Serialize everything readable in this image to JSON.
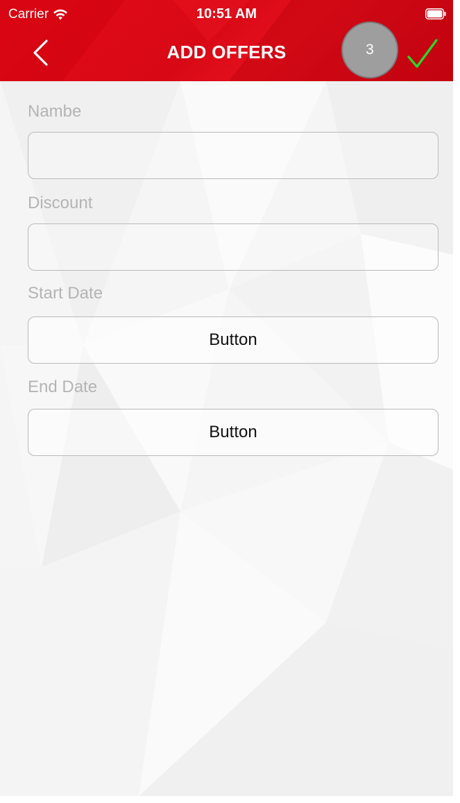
{
  "status_bar": {
    "carrier": "Carrier",
    "time": "10:51 AM",
    "wifi_icon": "wifi-icon",
    "battery_icon": "battery-icon"
  },
  "navbar": {
    "title": "ADD OFFERS",
    "back_icon": "chevron-left-icon",
    "badge_count": "3",
    "confirm_icon": "checkmark-icon",
    "background_color": "#e30613",
    "confirm_color": "#2bd62b"
  },
  "form": {
    "name": {
      "label": "Nambe",
      "value": "",
      "placeholder": ""
    },
    "discount": {
      "label": "Discount",
      "value": "",
      "placeholder": ""
    },
    "start_date": {
      "label": "Start Date",
      "button_label": "Button"
    },
    "end_date": {
      "label": "End Date",
      "button_label": "Button"
    }
  }
}
